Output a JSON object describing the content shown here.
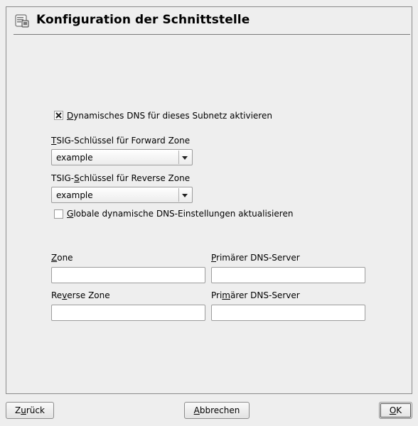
{
  "header": {
    "title": "Konfiguration der Schnittstelle",
    "icon": "network-config-icon"
  },
  "dns_update": {
    "checkbox_label_accel": "D",
    "checkbox_label_rest": "ynamisches DNS für dieses Subnetz aktivieren",
    "checked": true
  },
  "tsig_forward": {
    "label_accel": "T",
    "label_rest": "SIG-Schlüssel für Forward Zone",
    "value": "example"
  },
  "tsig_reverse": {
    "label_pre": "TSIG-",
    "label_accel": "S",
    "label_rest": "chlüssel für Reverse Zone",
    "value": "example"
  },
  "global_update": {
    "checkbox_label_accel": "G",
    "checkbox_label_rest": "lobale dynamische DNS-Einstellungen aktualisieren",
    "checked": false
  },
  "zone": {
    "label_accel": "Z",
    "label_rest": "one",
    "value": ""
  },
  "zone_primary": {
    "label_accel": "P",
    "label_rest": "rimärer DNS-Server",
    "value": ""
  },
  "reverse_zone": {
    "label_pre": "Re",
    "label_accel": "v",
    "label_rest": "erse Zone",
    "value": ""
  },
  "reverse_primary": {
    "label_pre": "Pri",
    "label_accel": "m",
    "label_rest": "ärer DNS-Server",
    "value": ""
  },
  "buttons": {
    "back_accel": "u",
    "back_pre": "Z",
    "back_rest": "rück",
    "abort_accel": "A",
    "abort_rest": "bbrechen",
    "ok_accel": "O",
    "ok_rest": "K"
  }
}
